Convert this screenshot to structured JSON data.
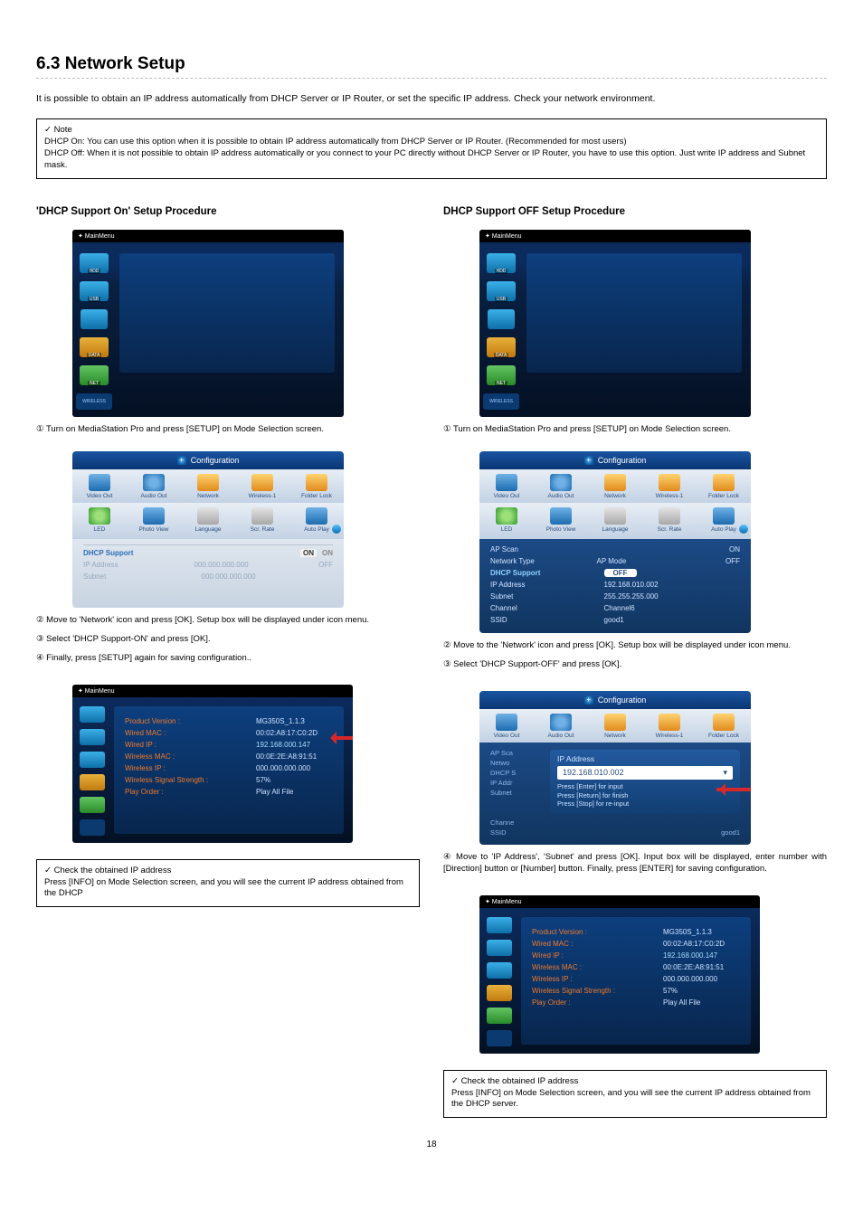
{
  "heading": "6.3 Network Setup",
  "intro": "It is possible to obtain an IP address automatically from DHCP Server or IP Router, or set the specific IP address. Check your network environment.",
  "note": {
    "label": "✓  Note",
    "line1": "DHCP On: You can use this option when it is possible to obtain IP address automatically from DHCP Server or IP Router. (Recommended for most users)",
    "line2": "DHCP Off: When it is not possible to obtain IP address automatically or you connect to your PC directly without DHCP Server or IP Router, you have to use this option. Just write IP address and Subnet mask."
  },
  "left": {
    "heading": "'DHCP Support On' Setup Procedure",
    "step1": "① Turn on MediaStation Pro and press [SETUP] on Mode Selection screen.",
    "step2": "② Move to 'Network' icon and press [OK]. Setup box will be displayed under icon menu.",
    "step3": "③ Select 'DHCP Support-ON' and press [OK].",
    "step4": "④ Finally, press [SETUP] again for saving configuration..",
    "tip_label": "✓  Check the obtained IP address",
    "tip_body": "Press [INFO] on Mode Selection screen, and you will see the current IP address obtained from the DHCP"
  },
  "right": {
    "heading": "DHCP Support OFF Setup Procedure",
    "step1": "① Turn on MediaStation Pro and press [SETUP] on Mode Selection screen.",
    "step2": "② Move to the 'Network' icon and press [OK]. Setup box will be displayed under icon menu.",
    "step3": "③ Select 'DHCP Support-OFF' and press [OK].",
    "step4": "④ Move to 'IP Address', 'Subnet' and press [OK]. Input box will be displayed, enter number with [Direction] button or [Number] button. Finally, press [ENTER] for saving configuration.",
    "tip_label": "✓  Check the obtained IP address",
    "tip_body": "Press [INFO] on Mode Selection screen, and you will see the current IP address obtained from the DHCP server."
  },
  "mainmenu": {
    "title": "✦ MainMenu",
    "icons": [
      "HDD",
      "USB",
      " ",
      "DATA",
      "NET"
    ],
    "wireless": "WIRELESS"
  },
  "config": {
    "title": "Configuration",
    "tabs_row1": [
      "Video Out",
      "Audio Out",
      "Network",
      "Wireless-1",
      "Folder Lock"
    ],
    "tabs_row2": [
      "LED",
      "Photo View",
      "Language",
      "Scr. Rate",
      "Auto Play"
    ],
    "on": {
      "dhcp_label": "DHCP Support",
      "dhcp_toggle_on": "ON",
      "dhcp_toggle_off": "ON",
      "ip_label": "IP Address",
      "ip_value": "000.000.000.000",
      "off_text": "OFF",
      "subnet_label": "Subnet",
      "subnet_value": "000.000.000.000"
    },
    "off": {
      "rows": [
        {
          "k": "AP Scan",
          "v": "",
          "r": "ON"
        },
        {
          "k": "Network Type",
          "v": "AP Mode",
          "r": "OFF"
        },
        {
          "k": "DHCP Support",
          "v": "OFF",
          "hi": true
        },
        {
          "k": "IP Address",
          "v": "192.168.010.002"
        },
        {
          "k": "Subnet",
          "v": "255.255.255.000"
        },
        {
          "k": "Channel",
          "v": "Channel6"
        },
        {
          "k": "SSID",
          "v": "good1"
        }
      ]
    }
  },
  "ipdlg": {
    "title": "IP Address",
    "value": "192.168.010.002",
    "hint1": "Press [Enter] for input",
    "hint2": "Press [Return] for finish",
    "hint3": "Press [Stop] for re-input",
    "low": [
      {
        "k": "AP Sca",
        "v": ""
      },
      {
        "k": "Netwo",
        "v": ""
      },
      {
        "k": "DHCP S",
        "v": ""
      },
      {
        "k": "IP Addr",
        "v": ""
      },
      {
        "k": "Subnet",
        "v": ""
      },
      {
        "k": "Channe",
        "v": ""
      },
      {
        "k": "SSID",
        "v": "good1"
      }
    ]
  },
  "info": {
    "rows": [
      {
        "k": "Product Version :",
        "v": "MG350S_1.1.3"
      },
      {
        "k": "Wired MAC :",
        "v": "00:02:A8:17:C0:2D"
      },
      {
        "k": "Wired IP :",
        "v": "192.168.000.147"
      },
      {
        "k": "Wireless MAC :",
        "v": "00:0E:2E:A8:91:51"
      },
      {
        "k": "Wireless IP :",
        "v": "000.000.000.000"
      },
      {
        "k": "Wireless Signal Strength :",
        "v": "57%"
      },
      {
        "k": "Play Order :",
        "v": "Play All File"
      }
    ]
  },
  "page": "18"
}
